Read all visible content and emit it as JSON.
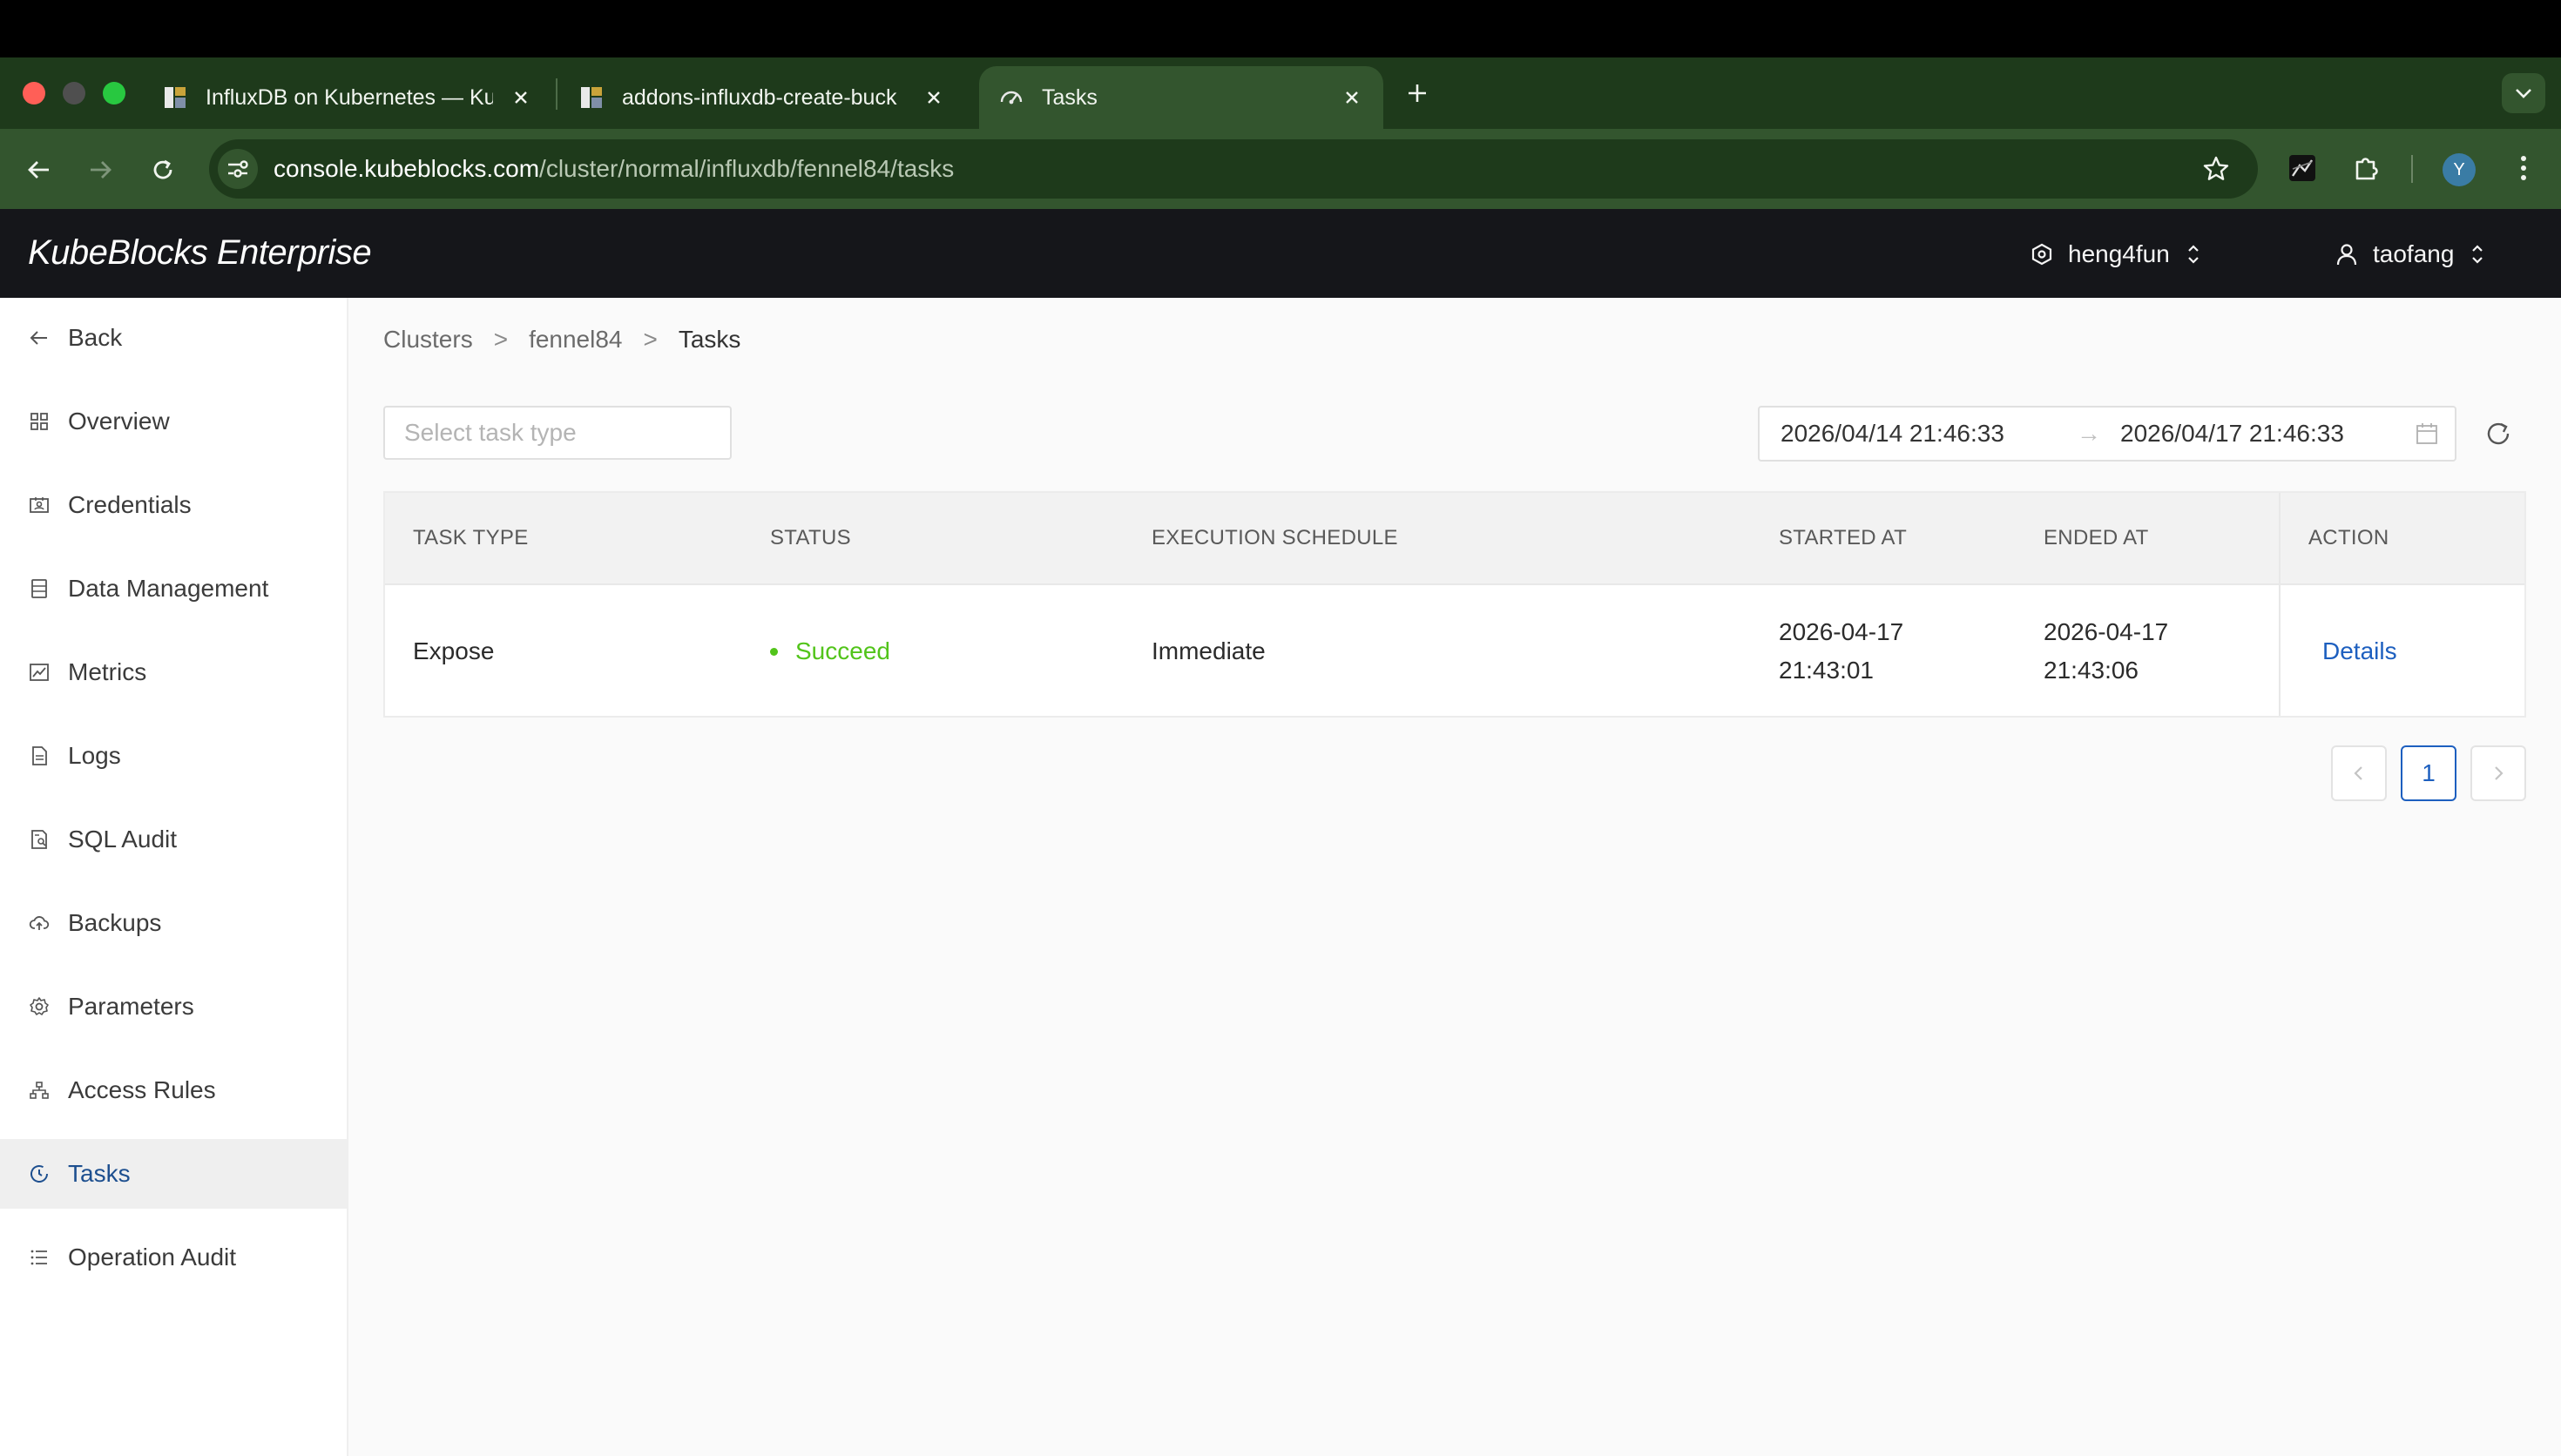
{
  "browser": {
    "tabs": [
      {
        "title": "InfluxDB on Kubernetes — Ku",
        "active": false
      },
      {
        "title": "addons-influxdb-create-buck",
        "active": false
      },
      {
        "title": "Tasks",
        "active": true
      }
    ],
    "url_host": "console.kubeblocks.com",
    "url_path": "/cluster/normal/influxdb/fennel84/tasks",
    "profile_initial": "Y"
  },
  "header": {
    "brand": "KubeBlocks Enterprise",
    "org": "heng4fun",
    "user": "taofang"
  },
  "sidebar": {
    "items": [
      {
        "label": "Back",
        "icon": "arrow-left-icon"
      },
      {
        "label": "Overview",
        "icon": "grid-icon"
      },
      {
        "label": "Credentials",
        "icon": "id-card-icon"
      },
      {
        "label": "Data Management",
        "icon": "database-icon"
      },
      {
        "label": "Metrics",
        "icon": "chart-icon"
      },
      {
        "label": "Logs",
        "icon": "file-icon"
      },
      {
        "label": "SQL Audit",
        "icon": "audit-icon"
      },
      {
        "label": "Backups",
        "icon": "cloud-upload-icon"
      },
      {
        "label": "Parameters",
        "icon": "gear-icon"
      },
      {
        "label": "Access Rules",
        "icon": "network-icon"
      },
      {
        "label": "Tasks",
        "icon": "clock-icon",
        "active": true
      },
      {
        "label": "Operation Audit",
        "icon": "list-icon"
      }
    ]
  },
  "breadcrumb": {
    "items": [
      "Clusters",
      "fennel84",
      "Tasks"
    ],
    "separator": ">"
  },
  "filters": {
    "task_type_placeholder": "Select task type",
    "range_start": "2026/04/14 21:46:33",
    "range_end": "2026/04/17 21:46:33",
    "range_arrow": "→"
  },
  "table": {
    "headers": [
      "TASK TYPE",
      "STATUS",
      "EXECUTION SCHEDULE",
      "STARTED AT",
      "ENDED AT",
      "ACTION"
    ],
    "rows": [
      {
        "task_type": "Expose",
        "status": "Succeed",
        "schedule": "Immediate",
        "started_date": "2026-04-17",
        "started_time": "21:43:01",
        "ended_date": "2026-04-17",
        "ended_time": "21:43:06",
        "action": "Details"
      }
    ]
  },
  "pagination": {
    "current_page": "1"
  },
  "colors": {
    "accent": "#1d5fbf",
    "success": "#52c41a",
    "appbar": "#15161a",
    "browser_chrome": "#33552e"
  }
}
